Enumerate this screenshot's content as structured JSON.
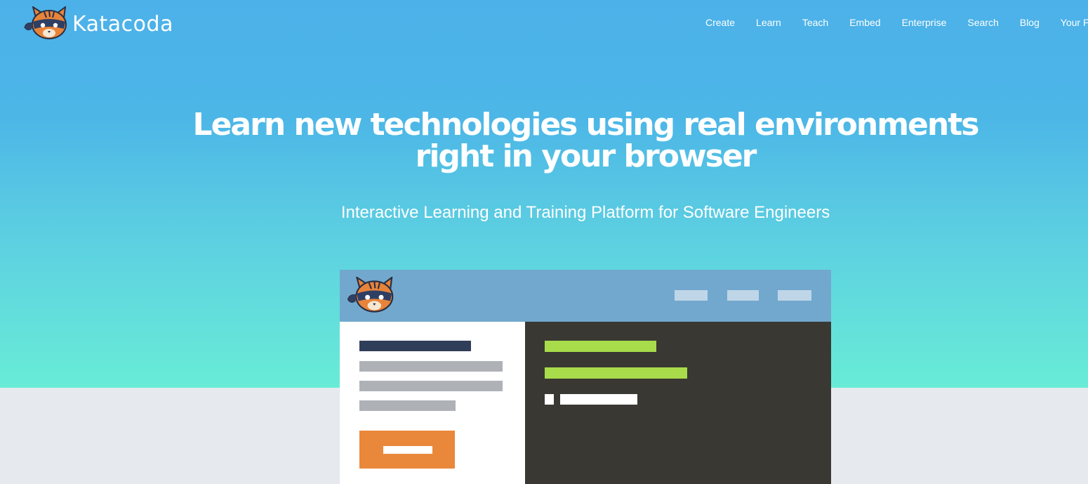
{
  "brand": {
    "name": "Katacoda",
    "logo_icon": "ninja-cat-logo-icon"
  },
  "nav": {
    "items": [
      {
        "label": "Create"
      },
      {
        "label": "Learn"
      },
      {
        "label": "Teach"
      },
      {
        "label": "Embed"
      },
      {
        "label": "Enterprise"
      },
      {
        "label": "Search"
      },
      {
        "label": "Blog"
      },
      {
        "label": "Your P"
      }
    ]
  },
  "hero": {
    "headline_line1": "Learn new technologies using real environments",
    "headline_line2": "right in your browser",
    "subtitle": "Interactive Learning and Training Platform for Software Engineers"
  },
  "colors": {
    "hero_top": "#4cb1e9",
    "hero_bottom": "#68ecd6",
    "page_background": "#e6eaee",
    "mock_header": "#72a8cd",
    "terminal_background": "#393833",
    "terminal_green": "#a8dc4a",
    "cta_orange": "#e9883b"
  }
}
